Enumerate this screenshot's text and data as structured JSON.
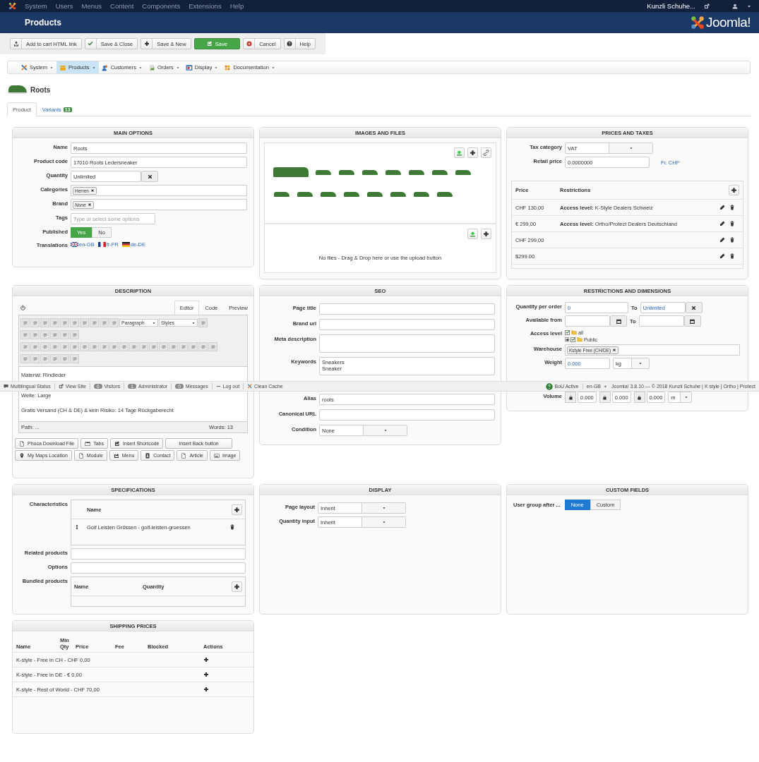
{
  "top_menu": {
    "items": [
      "System",
      "Users",
      "Menus",
      "Content",
      "Components",
      "Extensions",
      "Help"
    ],
    "site": "Kunzli Schuhe..."
  },
  "header": {
    "title": "Products",
    "brand": "Joomla!"
  },
  "toolbar": [
    {
      "label": "Add to cart HTML link",
      "kind": "upload"
    },
    {
      "label": "Save & Close",
      "kind": "check"
    },
    {
      "label": "Save & New",
      "kind": "plus"
    },
    {
      "label": "Save",
      "kind": "primary"
    },
    {
      "label": "Cancel",
      "kind": "cancel"
    },
    {
      "label": "Help",
      "kind": "help"
    }
  ],
  "submenu": [
    {
      "label": "System",
      "kind": "tools",
      "selected": false
    },
    {
      "label": "Products",
      "kind": "products",
      "selected": true
    },
    {
      "label": "Customers",
      "kind": "customers",
      "selected": false
    },
    {
      "label": "Orders",
      "kind": "orders",
      "selected": false
    },
    {
      "label": "Display",
      "kind": "display",
      "selected": false
    },
    {
      "label": "Documentation",
      "kind": "docs",
      "selected": false
    }
  ],
  "product": {
    "title": "Roots"
  },
  "tabs": [
    {
      "label": "Product",
      "selected": true
    },
    {
      "label": "Variants",
      "badge": "13",
      "selected": false
    }
  ],
  "main_options": {
    "title": "MAIN OPTIONS",
    "name": {
      "label": "Name",
      "value": "Roots"
    },
    "product_code": {
      "label": "Product code",
      "value": "17010 Roots Ledersneaker"
    },
    "quantity": {
      "label": "Quantity",
      "value": "Unlimited"
    },
    "categories": {
      "label": "Categories",
      "tags": [
        "Herren"
      ]
    },
    "brand": {
      "label": "Brand",
      "tags": [
        "None"
      ]
    },
    "tags": {
      "label": "Tags",
      "placeholder": "Type or select some options"
    },
    "published": {
      "label": "Published",
      "options": [
        {
          "label": "Yes",
          "selected": true
        },
        {
          "label": "No",
          "selected": false
        }
      ]
    },
    "translations": {
      "label": "Translations",
      "languages": [
        {
          "code": "en-GB",
          "kind": "gb"
        },
        {
          "code": "fr-FR",
          "kind": "fr"
        },
        {
          "code": "de-DE",
          "kind": "de"
        }
      ]
    }
  },
  "images": {
    "title": "IMAGES AND FILES",
    "files_message": "No files - Drag & Drop here or use the upload button"
  },
  "prices": {
    "title": "PRICES AND TAXES",
    "tax_category": {
      "label": "Tax category",
      "value": "VAT"
    },
    "retail_price": {
      "label": "Retail price",
      "value": "0.0000000",
      "currency": "Fr. CHF"
    },
    "columns": [
      "Price",
      "Restrictions"
    ],
    "rows": [
      {
        "price": "CHF 130,00",
        "restriction_label": "Access level:",
        "restriction": "K-Style Dealers Schweiz"
      },
      {
        "price": "€ 299,00",
        "restriction_label": "Access level:",
        "restriction": "Ortho/Protect Dealers Deutschland"
      },
      {
        "price": "CHF 299,00"
      },
      {
        "price": "$299.00"
      }
    ]
  },
  "description": {
    "title": "DESCRIPTION",
    "tabs": [
      {
        "label": "Editor",
        "selected": true
      },
      {
        "label": "Code",
        "selected": false
      },
      {
        "label": "Preview",
        "selected": false
      }
    ],
    "formats": [
      "Paragraph",
      "Styles"
    ],
    "content": [
      "Material: Rindleder",
      "Weite: Large",
      "Gratis Versand (CH & DE) & kein Risiko: 14 Tage Rückgaberecht"
    ],
    "path": "Path: ...",
    "words": "Words: 13",
    "buttons": [
      {
        "label": "Phoca Download File",
        "kind": "file"
      },
      {
        "label": "Tabs",
        "kind": "tabs"
      },
      {
        "label": "Insert Shortcode",
        "kind": "edit"
      },
      {
        "label": "Insert Back button",
        "kind": "none"
      },
      {
        "label": "My Maps Location",
        "kind": "pin"
      },
      {
        "label": "Module",
        "kind": "file"
      },
      {
        "label": "Menu",
        "kind": "share"
      },
      {
        "label": "Contact",
        "kind": "contact"
      },
      {
        "label": "Article",
        "kind": "file"
      },
      {
        "label": "Image",
        "kind": "image"
      }
    ]
  },
  "seo": {
    "title": "SEO",
    "page_title": {
      "label": "Page title"
    },
    "brand_url": {
      "label": "Brand url"
    },
    "meta_description": {
      "label": "Meta description"
    },
    "keywords": {
      "label": "Keywords",
      "lines": [
        "Sneakers",
        "Sneaker"
      ]
    },
    "alias": {
      "label": "Alias",
      "value": "roots"
    },
    "canonical_url": {
      "label": "Canonical URL"
    },
    "condition": {
      "label": "Condition",
      "value": "None"
    }
  },
  "restrictions": {
    "title": "RESTRICTIONS AND DIMENSIONS",
    "quantity_per_order": {
      "label": "Quantity per order",
      "from": "0",
      "to_label": "To",
      "to": "Unlimited"
    },
    "available_from": {
      "label": "Available from",
      "to_label": "To"
    },
    "access_level": {
      "label": "Access level",
      "tree": [
        {
          "label": "all",
          "checked": true,
          "children": [
            {
              "label": "Public",
              "checked": true,
              "expanded": false
            }
          ]
        }
      ]
    },
    "warehouse": {
      "label": "Warehouse",
      "tags": [
        "Kstyle Free (CH/DE)"
      ]
    },
    "weight": {
      "label": "Weight",
      "value": "0.000",
      "unit": "kg"
    },
    "volume": {
      "label": "Volume",
      "values": [
        "0.000",
        "0.000",
        "0.000"
      ],
      "unit": "m"
    }
  },
  "specifications": {
    "title": "SPECIFICATIONS",
    "characteristics": {
      "label": "Characteristics",
      "column": "Name",
      "rows": [
        "Golf Leisten Grössen - golf-leisten-groessen"
      ]
    },
    "related_products": {
      "label": "Related products"
    },
    "options": {
      "label": "Options"
    },
    "bundled_products": {
      "label": "Bundled products",
      "columns": [
        "Name",
        "Quantity"
      ]
    }
  },
  "display": {
    "title": "DISPLAY",
    "fields": [
      {
        "label": "Page layout",
        "value": "Inherit"
      },
      {
        "label": "Quantity input",
        "value": "Inherit"
      }
    ]
  },
  "custom_fields": {
    "title": "CUSTOM FIELDS",
    "label": "User group after ...",
    "options": [
      {
        "label": "None",
        "selected": true
      },
      {
        "label": "Custom",
        "selected": false
      }
    ]
  },
  "shipping": {
    "title": "SHIPPING PRICES",
    "columns": [
      "Name",
      "Min Qty",
      "Price",
      "Fee",
      "Blocked",
      "Actions"
    ],
    "rows": [
      "K-style - Free in CH - CHF 0,00",
      "K-style - Free in DE - € 0,00",
      "K-style - Rest of World - CHF 70,00"
    ]
  },
  "status_bar": {
    "left": [
      {
        "label": "Multilingual Status",
        "kind": "comment"
      },
      {
        "label": "View Site",
        "kind": "external"
      },
      {
        "label": "Visitors",
        "count": "0"
      },
      {
        "label": "Administrator",
        "count": "1"
      },
      {
        "label": "Messages",
        "count": "0"
      },
      {
        "label": "Log out",
        "kind": "minus"
      },
      {
        "label": "Clean Cache",
        "kind": "tools"
      }
    ],
    "bou": "BoU Active",
    "language": "en-GB",
    "footer": "Joomla! 3.8.10 — © 2018 Kunzli Schuhe | K style | Ortho | Protect"
  }
}
